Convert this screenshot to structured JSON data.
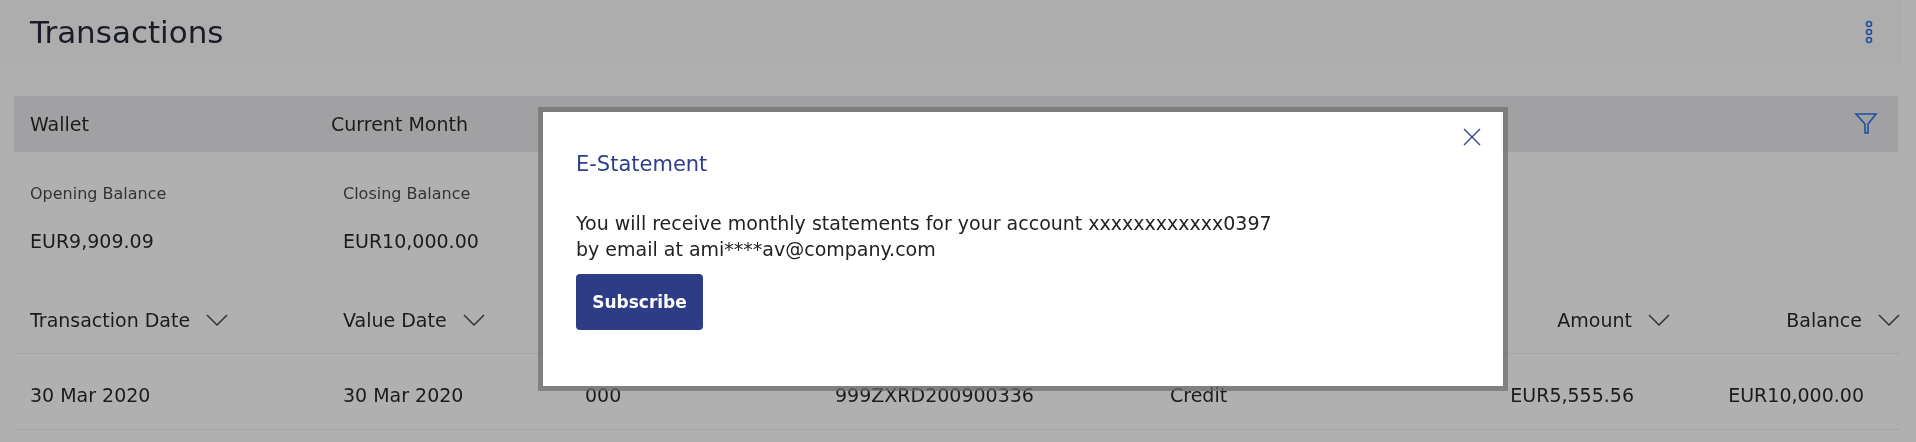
{
  "page": {
    "title": "Transactions"
  },
  "filter_bar": {
    "wallet": "Wallet",
    "period": "Current Month"
  },
  "balances": [
    {
      "label": "Opening Balance",
      "value": "EUR9,909.09"
    },
    {
      "label": "Closing Balance",
      "value": "EUR10,000.00"
    }
  ],
  "table": {
    "columns": [
      {
        "label": "Transaction Date"
      },
      {
        "label": "Value Date"
      },
      {
        "label": "Amount"
      },
      {
        "label": "Balance"
      }
    ],
    "rows": [
      {
        "transaction_date": "30 Mar 2020",
        "value_date": "30 Mar 2020",
        "column_3": "000",
        "column_4": "999ZXRD200900336",
        "column_5": "Credit",
        "amount": "EUR5,555.56",
        "balance": "EUR10,000.00"
      }
    ]
  },
  "dialog": {
    "title": "E-Statement",
    "message": [
      "You will receive monthly statements for your account xxxxxxxxxxxx0397",
      "by email at ami****av@company.com"
    ],
    "button": "Subscribe"
  }
}
